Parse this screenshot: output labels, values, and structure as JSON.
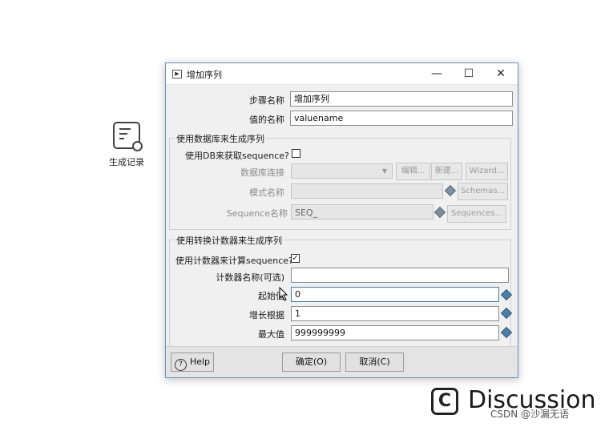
{
  "background_step": {
    "label": "生成记录",
    "icon": "step-record-icon"
  },
  "dialog": {
    "title": "增加序列",
    "title_icon": "window-icon",
    "controls": {
      "minimize": "—",
      "maximize": "☐",
      "close": "✕"
    }
  },
  "fields": {
    "step_name": {
      "label": "步骤名称",
      "value": "增加序列"
    },
    "value_name": {
      "label": "值的名称",
      "value": "valuename"
    }
  },
  "db_group": {
    "title": "使用数据库来生成序列",
    "use_db_label": "使用DB来获取sequence?",
    "use_db_checked": false,
    "connection_label": "数据库连接",
    "connection_value": "",
    "edit_button": "编辑...",
    "new_button": "新建...",
    "wizard_button": "Wizard...",
    "schema_label": "模式名称",
    "schema_value": "",
    "schemas_button": "Schemas...",
    "sequence_label": "Sequence名称",
    "sequence_value": "SEQ_",
    "sequences_button": "Sequences..."
  },
  "counter_group": {
    "title": "使用转换计数器来生成序列",
    "use_counter_label": "使用计数器来计算sequence?",
    "use_counter_checked": true,
    "check_mark": "✓",
    "counter_name_label": "计数器名称(可选)",
    "counter_name_value": "",
    "start_label": "起始值",
    "start_value": "0",
    "increment_label": "增长根据",
    "increment_value": "1",
    "max_label": "最大值",
    "max_value": "999999999"
  },
  "buttons": {
    "help": "Help",
    "help_glyph": "?",
    "ok": "确定(O)",
    "cancel": "取消(C)"
  },
  "watermark": {
    "logo_glyph": "C",
    "text": "Discussion",
    "credit": "CSDN @沙漏无语"
  }
}
